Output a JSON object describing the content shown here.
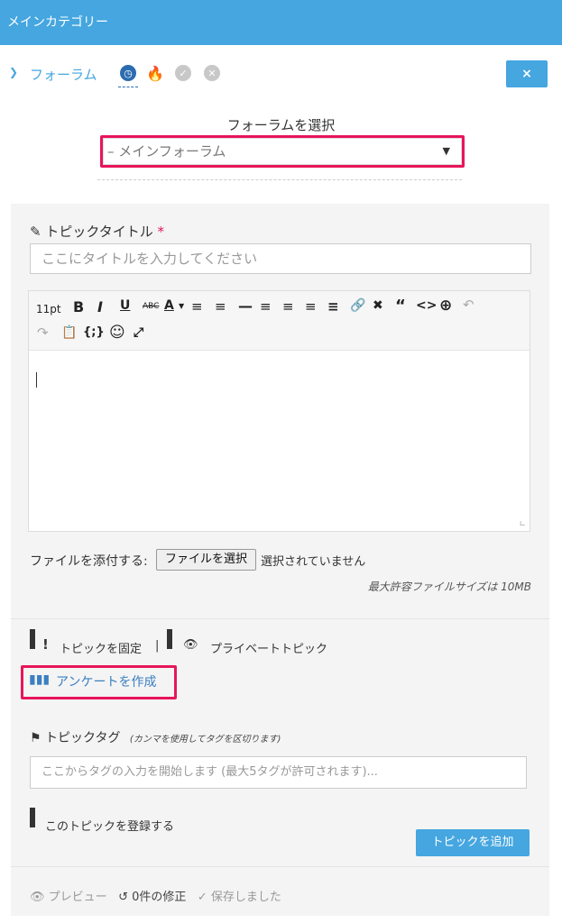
{
  "header": {
    "title": "メインカテゴリー"
  },
  "nav": {
    "forum_link": "フォーラム",
    "tabs": [
      "recent",
      "hot",
      "solved",
      "unsolved"
    ],
    "close_label": "×"
  },
  "forum_select": {
    "label": "フォーラムを選択",
    "value": "– メインフォーラム"
  },
  "topic": {
    "title_label": "トピックタイトル",
    "required_mark": "*",
    "title_placeholder": "ここにタイトルを入力してください"
  },
  "editor": {
    "font_size": "11pt",
    "tools": [
      "bold",
      "italic",
      "underline",
      "strikethrough",
      "text-color",
      "bullet-list",
      "numbered-list",
      "horizontal-rule",
      "align-left",
      "align-center",
      "align-right",
      "justify",
      "link",
      "unlink",
      "blockquote",
      "code",
      "insert",
      "undo",
      "redo",
      "paste",
      "code-block",
      "emoji",
      "fullscreen"
    ]
  },
  "attachment": {
    "label": "ファイルを添付する:",
    "button": "ファイルを選択",
    "status": "選択されていません",
    "max_size": "最大許容ファイルサイズは 10MB"
  },
  "options": {
    "sticky": "トピックを固定",
    "separator": "|",
    "private": "プライベートトピック",
    "poll": "アンケートを作成"
  },
  "tags": {
    "label": "トピックタグ",
    "hint": "(カンマを使用してタグを区切ります)",
    "placeholder": "ここからタグの入力を開始します (最大5タグが許可されます)..."
  },
  "subscribe": {
    "label": "このトピックを登録する"
  },
  "submit": {
    "label": "トピックを追加"
  },
  "footer": {
    "preview": "プレビュー",
    "revisions": "0件の修正",
    "saved": "保存しました"
  },
  "colors": {
    "accent": "#45a6e0",
    "highlight": "#e8155a"
  }
}
